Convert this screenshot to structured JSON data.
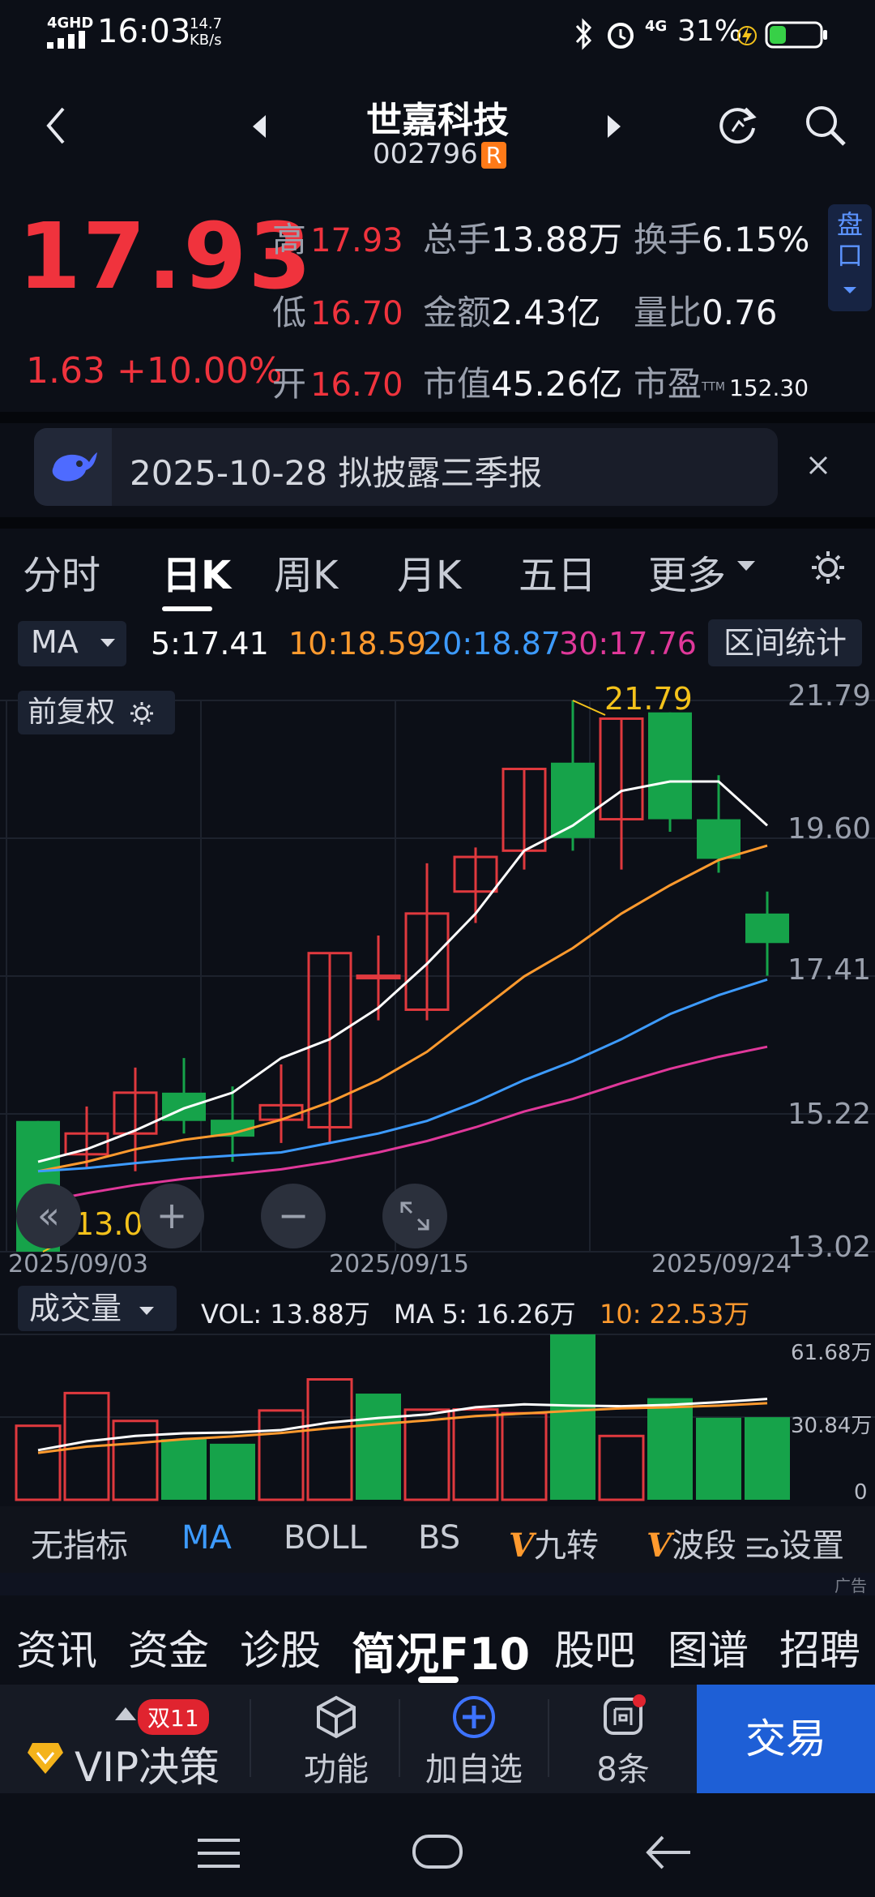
{
  "status_bar": {
    "network": "4GHD",
    "time": "16:03",
    "speed_value": "14.7",
    "speed_unit": "KB/s",
    "signal2": "4G",
    "battery": "31%"
  },
  "header": {
    "title": "世嘉科技",
    "code": "002796",
    "badge": "R"
  },
  "quote": {
    "price": "17.93",
    "change": "1.63 +10.00%",
    "high_label": "高",
    "high": "17.93",
    "low_label": "低",
    "low": "16.70",
    "open_label": "开",
    "open": "16.70",
    "volume_label": "总手",
    "volume": "13.88万",
    "amount_label": "金额",
    "amount": "2.43亿",
    "mcap_label": "市值",
    "mcap": "45.26亿",
    "turnover_label": "换手",
    "turnover": "6.15%",
    "vol_ratio_label": "量比",
    "vol_ratio": "0.76",
    "pe_label": "市盈",
    "pe_sup": "TTM",
    "pe": "152.30",
    "pankou_label": "盘口"
  },
  "notice": {
    "text": "2025-10-28 拟披露三季报"
  },
  "chart_tabs": [
    "分时",
    "日K",
    "周K",
    "月K",
    "五日",
    "更多"
  ],
  "chart_tabs_active": "日K",
  "ma_row": {
    "selector": "MA",
    "ma5": "5:17.41",
    "ma10": "10:18.59",
    "ma20": "20:18.87",
    "ma30": "30:17.76",
    "range_stats": "区间统计",
    "colors": {
      "ma5": "#ffffff",
      "ma10": "#ff9a2e",
      "ma20": "#3d9bff",
      "ma30": "#e0389a"
    }
  },
  "kline": {
    "adjust_label": "前复权",
    "y_labels": [
      "21.79",
      "19.60",
      "17.41",
      "15.22",
      "13.02"
    ],
    "x_labels": [
      "2025/09/03",
      "2025/09/15",
      "2025/09/24"
    ],
    "high_marker": "21.79",
    "low_marker": "13.02"
  },
  "volume_panel": {
    "selector": "成交量",
    "vol": "VOL: 13.88万",
    "ma5": "MA 5: 16.26万",
    "ma10": "10: 22.53万",
    "y_labels": [
      "61.68万",
      "30.84万",
      "0"
    ]
  },
  "indicators": [
    "无指标",
    "MA",
    "BOLL",
    "BS",
    "九转",
    "波段",
    "设置"
  ],
  "indicators_active": "MA",
  "ad_label": "广告",
  "bottom_tabs": [
    "资讯",
    "资金",
    "诊股",
    "简况F10",
    "股吧",
    "图谱",
    "招聘"
  ],
  "bottom_tabs_active": "简况F10",
  "toolbar": {
    "vip": "VIP决策",
    "vip_badge": "双11",
    "func": "功能",
    "add": "加自选",
    "msg": "8条",
    "trade": "交易"
  },
  "chart_data": [
    {
      "type": "candlestick",
      "x": [
        "2025/09/03",
        "",
        "",
        "",
        "",
        "",
        "",
        "2025/09/15",
        "",
        "",
        "",
        "",
        "",
        "",
        "",
        "2025/09/24"
      ],
      "ohlc": [
        [
          15.1,
          13.02,
          13.7,
          15.1
        ],
        [
          14.57,
          14.9,
          14.34,
          15.33
        ],
        [
          14.9,
          15.55,
          14.3,
          15.95
        ],
        [
          15.55,
          15.1,
          14.9,
          16.1
        ],
        [
          15.12,
          14.85,
          14.45,
          15.65
        ],
        [
          15.12,
          15.35,
          14.75,
          16.0
        ],
        [
          15.0,
          17.77,
          14.75,
          17.77
        ],
        [
          17.41,
          17.41,
          16.7,
          18.05
        ],
        [
          16.87,
          18.4,
          16.7,
          19.2
        ],
        [
          18.75,
          19.3,
          18.25,
          19.45
        ],
        [
          19.4,
          20.7,
          19.1,
          20.7
        ],
        [
          20.8,
          19.6,
          19.4,
          21.79
        ],
        [
          19.9,
          21.5,
          19.1,
          21.5
        ],
        [
          21.6,
          19.9,
          19.7,
          21.6
        ],
        [
          19.9,
          19.27,
          19.05,
          20.6
        ],
        [
          18.4,
          17.93,
          17.41,
          18.75
        ]
      ],
      "ma": {
        "MA5": [
          14.45,
          14.65,
          14.95,
          15.3,
          15.55,
          16.1,
          16.4,
          16.9,
          17.6,
          18.4,
          19.4,
          19.8,
          20.35,
          20.5,
          20.5,
          19.8
        ],
        "MA10": [
          14.3,
          14.45,
          14.65,
          14.8,
          14.9,
          15.12,
          15.4,
          15.75,
          16.2,
          16.8,
          17.4,
          17.85,
          18.4,
          18.85,
          19.25,
          19.48
        ],
        "MA20": [
          14.3,
          14.35,
          14.43,
          14.5,
          14.55,
          14.6,
          14.75,
          14.9,
          15.1,
          15.4,
          15.75,
          16.05,
          16.4,
          16.8,
          17.1,
          17.35
        ],
        "MA30": [
          13.8,
          13.95,
          14.08,
          14.18,
          14.25,
          14.33,
          14.45,
          14.6,
          14.78,
          15.0,
          15.25,
          15.45,
          15.7,
          15.93,
          16.12,
          16.28
        ]
      }
    },
    {
      "type": "bar",
      "title": "成交量",
      "unit": "万",
      "values": [
        27.6,
        39.8,
        29.4,
        22.6,
        20.9,
        33.3,
        44.9,
        39.6,
        33.6,
        33.7,
        32.3,
        61.7,
        23.8,
        37.9,
        30.6,
        30.8
      ],
      "up": [
        true,
        true,
        true,
        false,
        false,
        true,
        true,
        false,
        true,
        true,
        true,
        false,
        true,
        false,
        false,
        false
      ],
      "ma5": [
        18.5,
        21.8,
        23.8,
        24.8,
        25.1,
        26.0,
        28.8,
        30.5,
        31.8,
        34.5,
        35.6,
        35.1,
        34.9,
        35.4,
        36.4,
        37.6
      ],
      "ma10": [
        17.5,
        19.8,
        21.1,
        22.6,
        23.6,
        24.9,
        26.7,
        28.2,
        29.6,
        31.2,
        32.2,
        33.2,
        34.1,
        34.5,
        35.1,
        36.0
      ],
      "ylim": [
        0,
        61.68
      ]
    }
  ]
}
